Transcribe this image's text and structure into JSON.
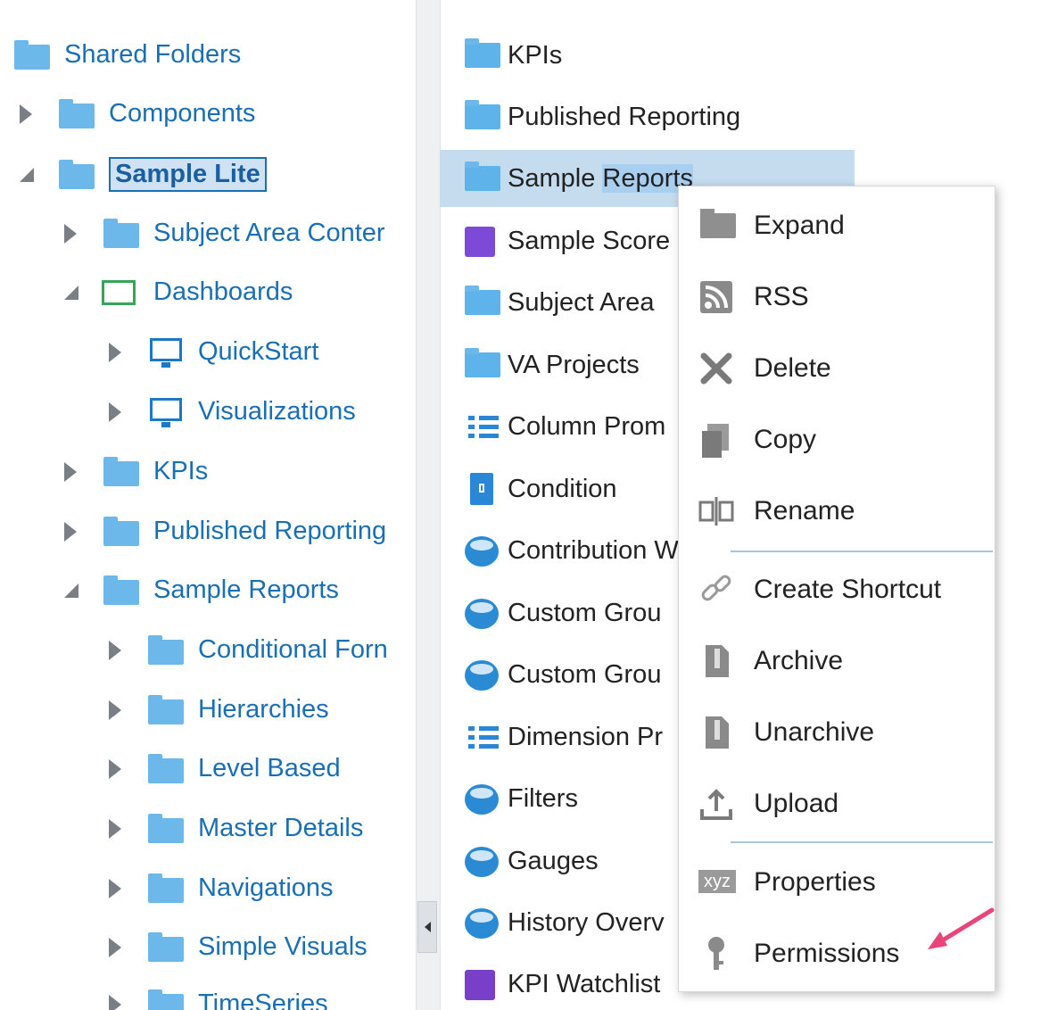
{
  "tree": {
    "items": [
      {
        "label": "Shared Folders",
        "icon": "folder-icon",
        "arrow": "none",
        "selected": false
      },
      {
        "label": "Components",
        "icon": "folder-icon",
        "arrow": "collapsed",
        "selected": false
      },
      {
        "label": "Sample Lite",
        "icon": "folder-icon",
        "arrow": "expanded",
        "selected": true
      },
      {
        "label": "Subject Area Conter",
        "icon": "folder-icon",
        "arrow": "collapsed",
        "selected": false
      },
      {
        "label": "Dashboards",
        "icon": "dashboard-folder-icon",
        "arrow": "expanded",
        "selected": false
      },
      {
        "label": "QuickStart",
        "icon": "dashboard-icon",
        "arrow": "collapsed",
        "selected": false
      },
      {
        "label": "Visualizations",
        "icon": "dashboard-icon",
        "arrow": "collapsed",
        "selected": false
      },
      {
        "label": "KPIs",
        "icon": "folder-icon",
        "arrow": "collapsed",
        "selected": false
      },
      {
        "label": "Published Reporting",
        "icon": "folder-icon",
        "arrow": "collapsed",
        "selected": false
      },
      {
        "label": "Sample Reports",
        "icon": "folder-icon",
        "arrow": "expanded",
        "selected": false
      },
      {
        "label": "Conditional Forn",
        "icon": "folder-icon",
        "arrow": "collapsed",
        "selected": false
      },
      {
        "label": "Hierarchies",
        "icon": "folder-icon",
        "arrow": "collapsed",
        "selected": false
      },
      {
        "label": "Level Based",
        "icon": "folder-icon",
        "arrow": "collapsed",
        "selected": false
      },
      {
        "label": "Master Details",
        "icon": "folder-icon",
        "arrow": "collapsed",
        "selected": false
      },
      {
        "label": "Navigations",
        "icon": "folder-icon",
        "arrow": "collapsed",
        "selected": false
      },
      {
        "label": "Simple Visuals",
        "icon": "folder-icon",
        "arrow": "collapsed",
        "selected": false
      },
      {
        "label": "TimeSeries",
        "icon": "folder-icon",
        "arrow": "collapsed",
        "selected": false
      }
    ]
  },
  "list": {
    "items": [
      {
        "label": "KPIs",
        "icon": "folder-icon"
      },
      {
        "label": "Published Reporting",
        "icon": "folder-icon"
      },
      {
        "label_pre": "Sample ",
        "label_hl": "Reports",
        "icon": "folder-icon",
        "selected": true
      },
      {
        "label": "Sample Score",
        "icon": "scorecard-icon"
      },
      {
        "label": "Subject Area",
        "icon": "folder-icon"
      },
      {
        "label": "VA Projects",
        "icon": "folder-icon"
      },
      {
        "label": "Column Prom",
        "icon": "prompt-icon"
      },
      {
        "label": "Condition",
        "icon": "condition-icon"
      },
      {
        "label": "Contribution W",
        "icon": "analysis-icon"
      },
      {
        "label": "Custom Grou",
        "icon": "analysis-icon"
      },
      {
        "label": "Custom Grou",
        "icon": "analysis-icon"
      },
      {
        "label": "Dimension Pr",
        "icon": "prompt-icon"
      },
      {
        "label": "Filters",
        "icon": "analysis-icon"
      },
      {
        "label": "Gauges",
        "icon": "analysis-icon"
      },
      {
        "label": "History Overv",
        "icon": "analysis-icon"
      },
      {
        "label": "KPI Watchlist",
        "icon": "kpi-watchlist-icon"
      }
    ]
  },
  "menu": {
    "items": [
      {
        "label": "Expand",
        "icon": "folder-icon"
      },
      {
        "label": "RSS",
        "icon": "rss-icon"
      },
      {
        "label": "Delete",
        "icon": "delete-icon"
      },
      {
        "label": "Copy",
        "icon": "copy-icon"
      },
      {
        "label": "Rename",
        "icon": "rename-icon"
      },
      {
        "label": "Create Shortcut",
        "icon": "shortcut-icon"
      },
      {
        "label": "Archive",
        "icon": "archive-icon"
      },
      {
        "label": "Unarchive",
        "icon": "unarchive-icon"
      },
      {
        "label": "Upload",
        "icon": "upload-icon"
      },
      {
        "label": "Properties",
        "icon": "properties-icon"
      },
      {
        "label": "Permissions",
        "icon": "permissions-icon"
      }
    ],
    "properties_icon_text": "xyz"
  },
  "colors": {
    "tree_link": "#1a6fb4",
    "selection": "#c5dcee",
    "folder": "#6cb8ea",
    "arrow_annotation": "#e8457a"
  }
}
